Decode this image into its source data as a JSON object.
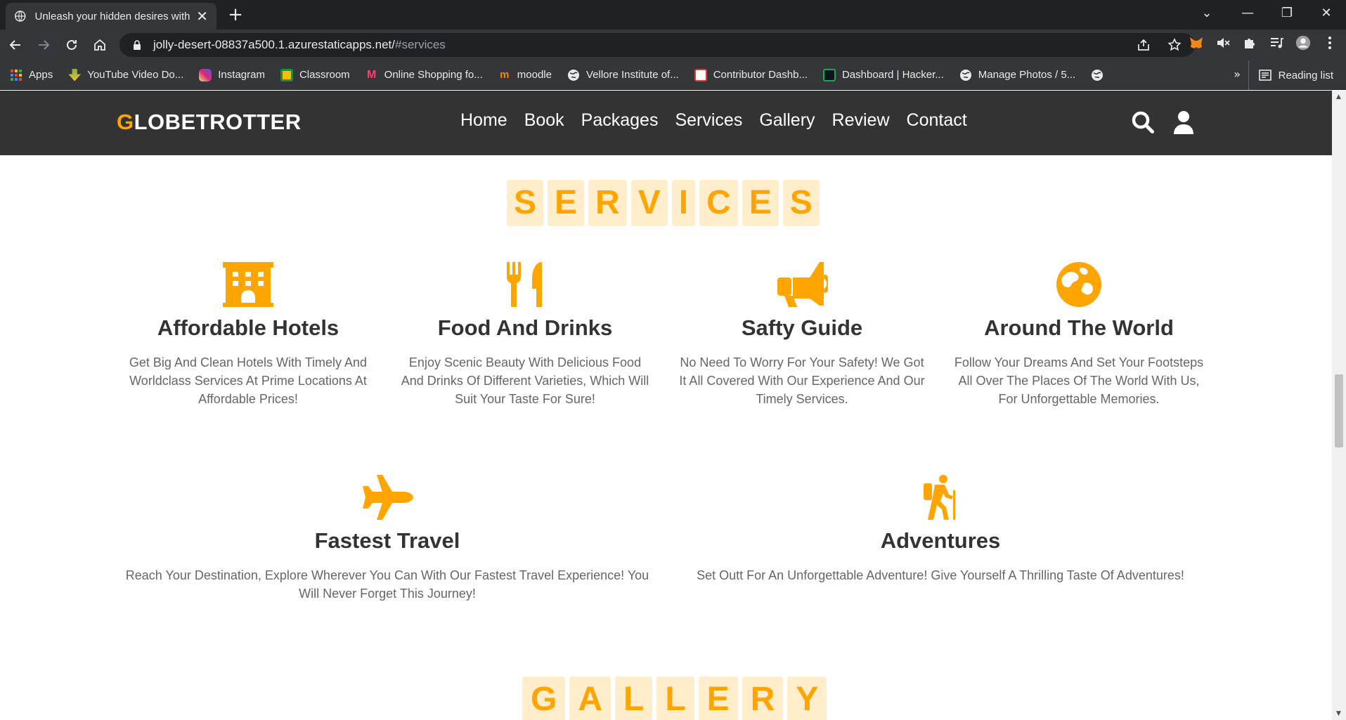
{
  "browser": {
    "tab_title": "Unleash your hidden desires with",
    "url_main": "jolly-desert-08837a500.1.azurestaticapps.net/",
    "url_hash": "#services",
    "bookmarks": [
      {
        "label": "Apps",
        "color": "#ea4335"
      },
      {
        "label": "YouTube Video Do...",
        "color": "#7cb342"
      },
      {
        "label": "Instagram",
        "color": "#e1306c"
      },
      {
        "label": "Classroom",
        "color": "#fbbc04"
      },
      {
        "label": "Online Shopping fo...",
        "color": "#ff3f6c"
      },
      {
        "label": "moodle",
        "color": "#f98012"
      },
      {
        "label": "Vellore Institute of...",
        "color": "#e8eaed"
      },
      {
        "label": "Contributor Dashb...",
        "color": "#e53935"
      },
      {
        "label": "Dashboard | Hacker...",
        "color": "#1ba94c"
      },
      {
        "label": "Manage Photos / 5...",
        "color": "#e8eaed"
      }
    ],
    "more_label": "»",
    "reading_list": "Reading list"
  },
  "site": {
    "logo_first": "G",
    "logo_rest": "LOBETROTTER",
    "nav": [
      "Home",
      "Book",
      "Packages",
      "Services",
      "Gallery",
      "Review",
      "Contact"
    ]
  },
  "services": {
    "heading_letters": [
      "S",
      "E",
      "R",
      "V",
      "I",
      "C",
      "E",
      "S"
    ],
    "items": [
      {
        "title": "Affordable Hotels",
        "text": "Get Big And Clean Hotels With Timely And Worldclass Services At Prime Locations At Affordable Prices!"
      },
      {
        "title": "Food And Drinks",
        "text": "Enjoy Scenic Beauty With Delicious Food And Drinks Of Different Varieties, Which Will Suit Your Taste For Sure!"
      },
      {
        "title": "Safty Guide",
        "text": "No Need To Worry For Your Safety! We Got It All Covered With Our Experience And Our Timely Services."
      },
      {
        "title": "Around The World",
        "text": "Follow Your Dreams And Set Your Footsteps All Over The Places Of The World With Us, For Unforgettable Memories."
      },
      {
        "title": "Fastest Travel",
        "text": "Reach Your Destination, Explore Wherever You Can With Our Fastest Travel Experience! You Will Never Forget This Journey!"
      },
      {
        "title": "Adventures",
        "text": "Set Outt For An Unforgettable Adventure! Give Yourself A Thrilling Taste Of Adventures!"
      }
    ]
  },
  "gallery": {
    "heading_letters": [
      "G",
      "A",
      "L",
      "L",
      "E",
      "R",
      "Y"
    ]
  },
  "colors": {
    "accent": "#ffa500",
    "header_bg": "#333333"
  }
}
